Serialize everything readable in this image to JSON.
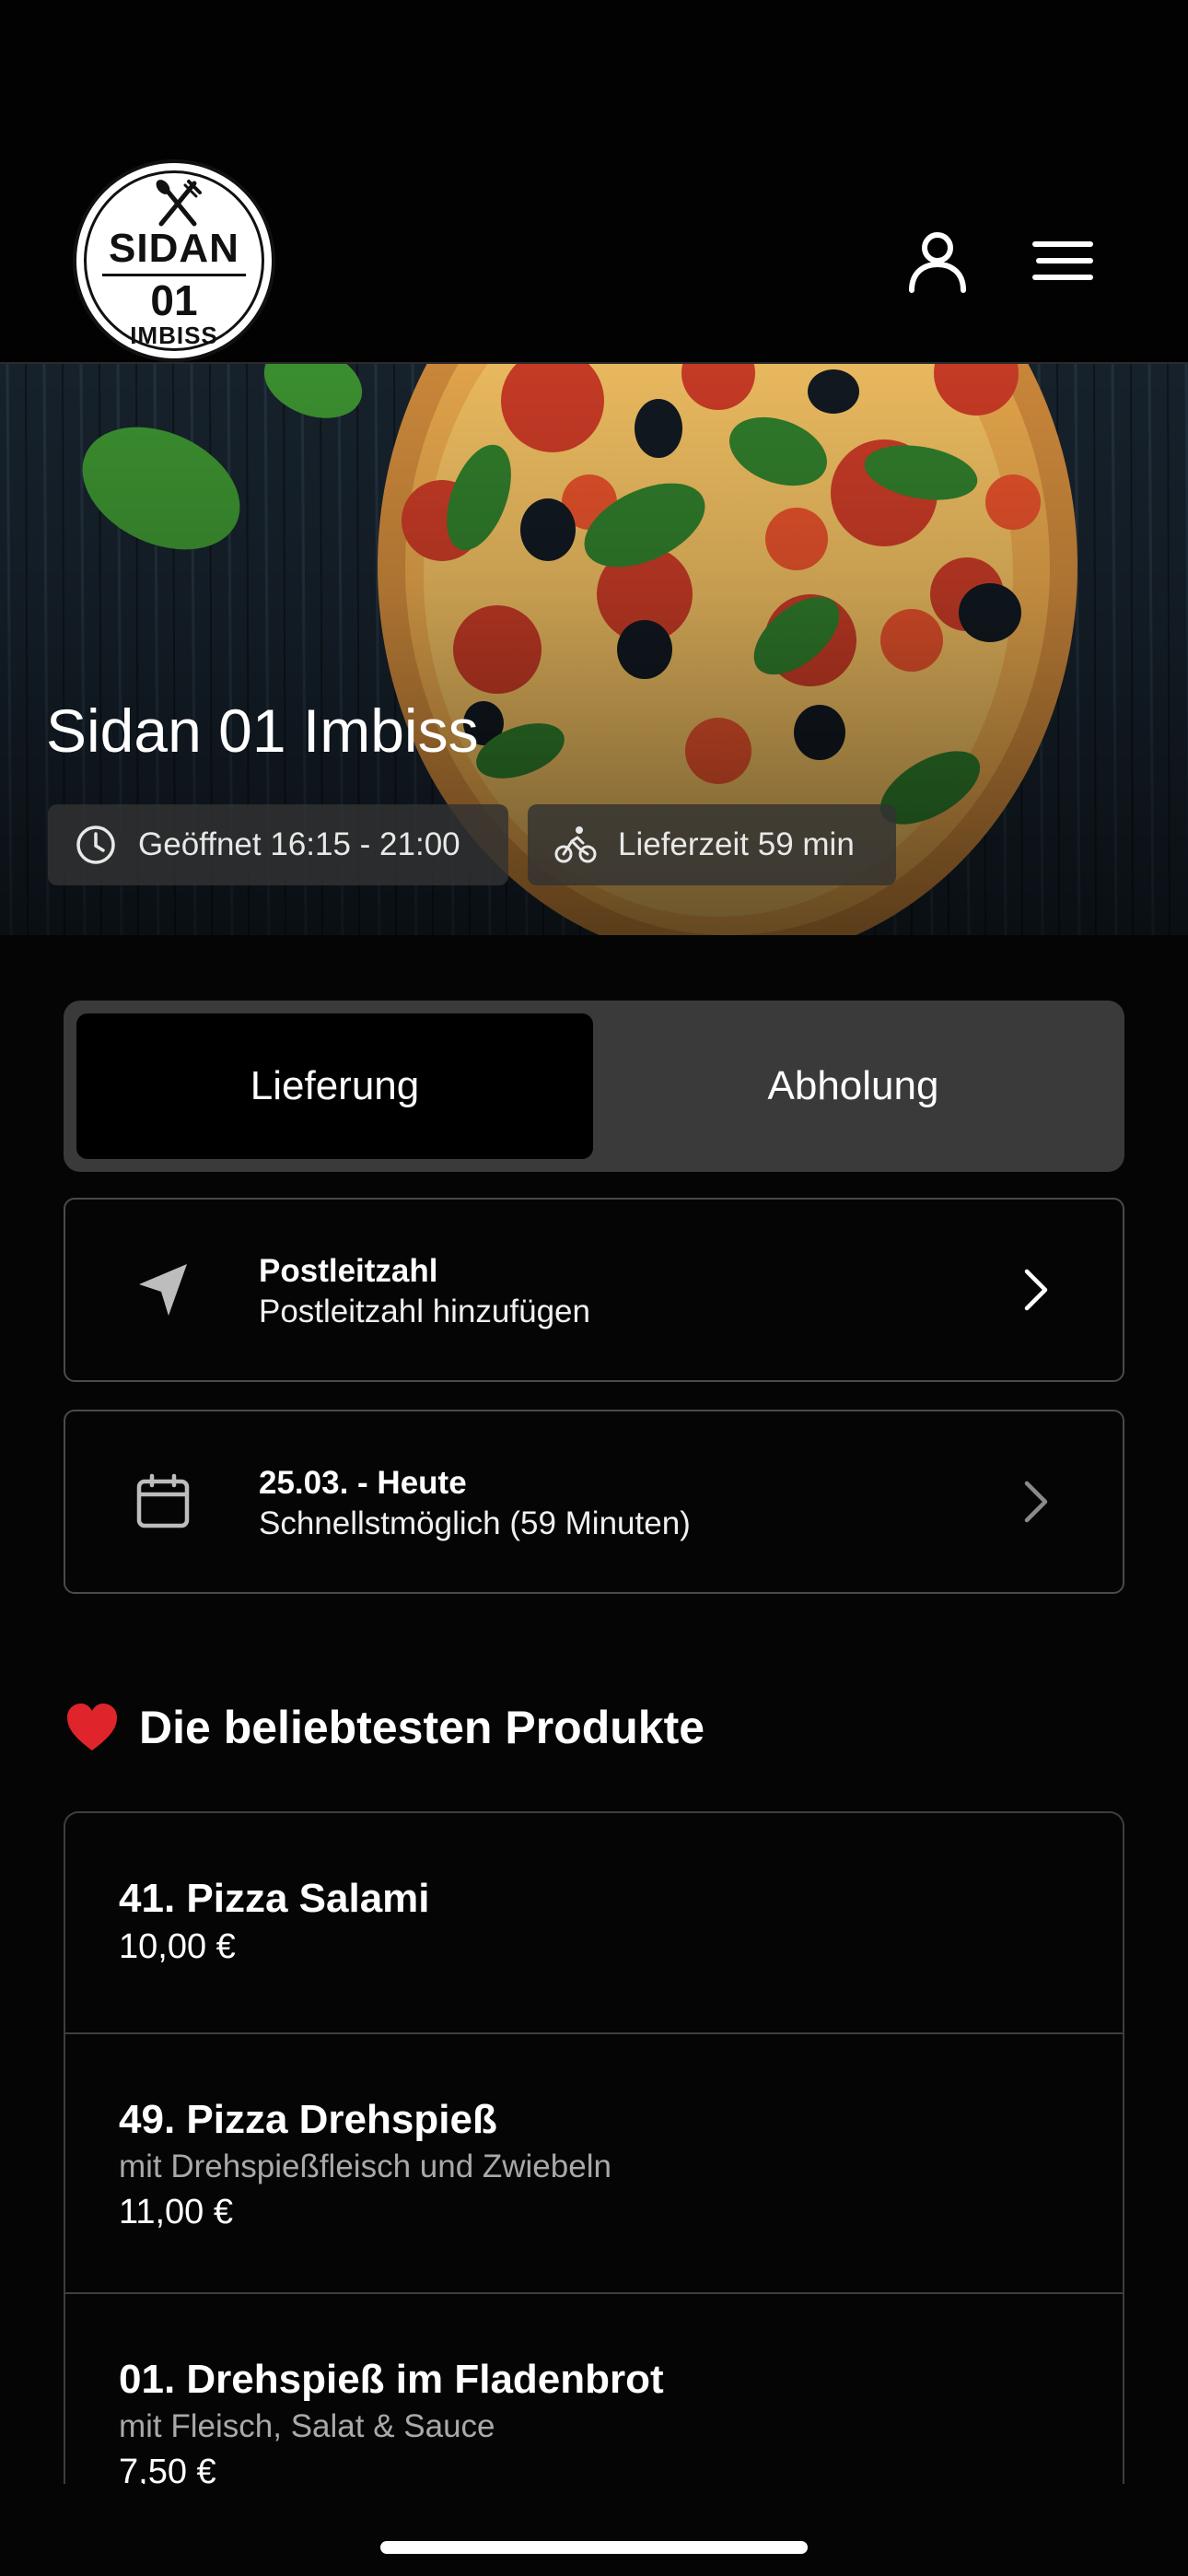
{
  "header": {
    "logo": {
      "line1": "SIDAN",
      "line2": "01",
      "line3": "IMBISS"
    },
    "icons": {
      "account": "user-icon",
      "menu": "hamburger-menu-icon"
    }
  },
  "hero": {
    "title": "Sidan 01 Imbiss",
    "opening_hours": "Geöffnet 16:15 - 21:00",
    "delivery_time": "Lieferzeit 59 min",
    "icons": {
      "opening_hours": "clock-icon",
      "delivery_time": "bicycle-icon"
    }
  },
  "order_mode": {
    "options": [
      "Lieferung",
      "Abholung"
    ],
    "selected": "Lieferung"
  },
  "postal_code": {
    "title": "Postleitzahl",
    "subtitle": "Postleitzahl hinzufügen",
    "icon": "location-arrow-icon"
  },
  "schedule": {
    "title": "25.03. - Heute",
    "subtitle": "Schnellstmöglich (59 Minuten)",
    "icon": "calendar-icon"
  },
  "popular": {
    "title": "Die beliebtesten Produkte",
    "icon": "heart-icon",
    "items": [
      {
        "name": "41. Pizza Salami",
        "description": "",
        "price": "10,00 €"
      },
      {
        "name": "49. Pizza Drehspieß",
        "description": "mit Drehspießfleisch und Zwiebeln",
        "price": "11,00 €"
      },
      {
        "name": "01. Drehspieß im Fladenbrot",
        "description": "mit Fleisch, Salat & Sauce",
        "price": "7,50 €"
      }
    ]
  },
  "colors": {
    "background": "#050505",
    "card_border": "#4a4a4a",
    "toggle_bg": "#3a3a3a",
    "toggle_active": "#000000",
    "heart": "#e0242b"
  }
}
